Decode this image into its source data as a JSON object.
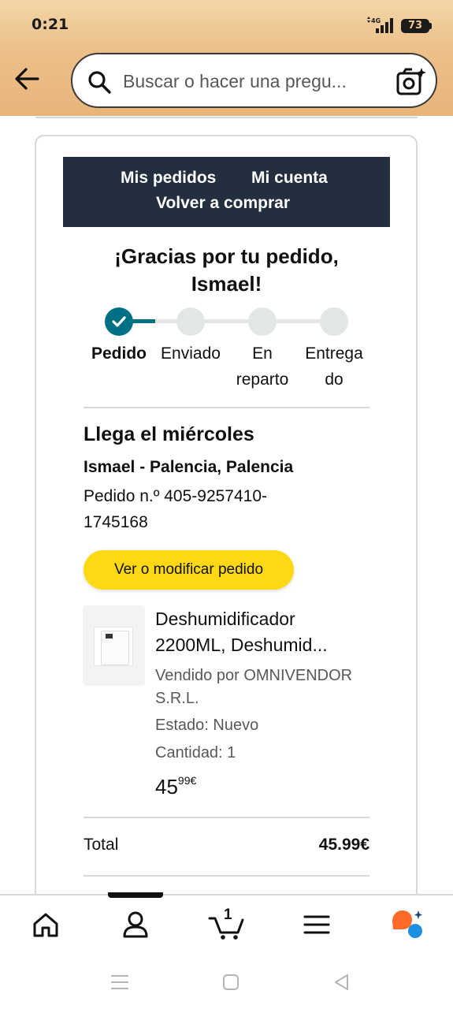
{
  "status_bar": {
    "time": "0:21",
    "network": "4G",
    "battery": "73"
  },
  "search": {
    "placeholder": "Buscar o hacer una pregu..."
  },
  "nav_links": {
    "orders": "Mis pedidos",
    "account": "Mi cuenta",
    "buy_again": "Volver a comprar"
  },
  "confirmation": {
    "thanks_line1": "¡Gracias por tu pedido,",
    "thanks_line2": "Ismael!"
  },
  "tracker": {
    "steps": [
      {
        "line1": "Pedido",
        "line2": ""
      },
      {
        "line1": "Enviado",
        "line2": ""
      },
      {
        "line1": "En",
        "line2": "reparto"
      },
      {
        "line1": "Entrega",
        "line2": "do"
      }
    ],
    "completed_step": 1
  },
  "delivery": {
    "arrival": "Llega el miércoles",
    "address": "Ismael - Palencia, Palencia",
    "order_number_line1": "Pedido n.º 405-9257410-",
    "order_number_line2": "1745168"
  },
  "actions": {
    "view_modify": "Ver o modificar pedido"
  },
  "product": {
    "title_line1": "Deshumidificador",
    "title_line2": "2200ML, Deshumid...",
    "seller_line1": "Vendido por OMNIVENDOR",
    "seller_line2": "S.R.L.",
    "condition": "Estado: Nuevo",
    "quantity": "Cantidad: 1",
    "price_whole": "45",
    "price_fraction": "99€"
  },
  "summary": {
    "total_label": "Total",
    "total_value": "45.99€"
  },
  "bottom_nav": {
    "cart_count": "1"
  },
  "colors": {
    "header": "#e8b57a",
    "nav_box": "#232f3e",
    "accent": "#007185",
    "button": "#ffd814"
  }
}
